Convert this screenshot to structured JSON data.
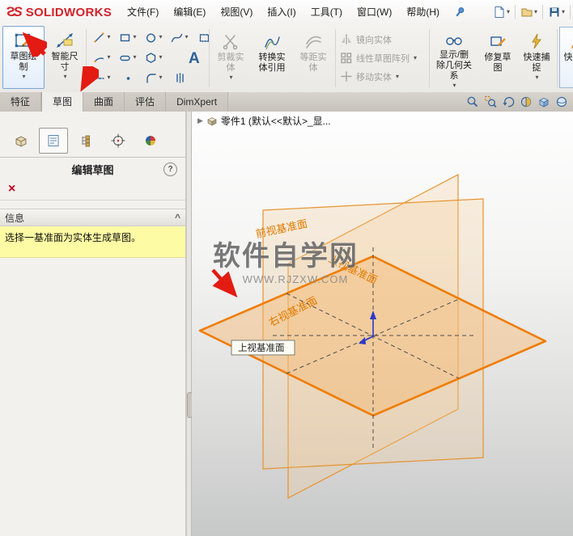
{
  "menubar": {
    "logo_mark": "S",
    "logo": "SOLIDWORKS",
    "menus": [
      "文件(F)",
      "编辑(E)",
      "视图(V)",
      "插入(I)",
      "工具(T)",
      "窗口(W)",
      "帮助(H)"
    ]
  },
  "icons": {
    "dropdown": "▾",
    "expand_arrow": "▶",
    "collapse_chevron": "^",
    "close": "×",
    "help": "?",
    "text_tool": "A"
  },
  "ribbon": {
    "sketch": "草图绘制",
    "smart_dimension": "智能尺寸",
    "trim_entities": "剪裁实体",
    "convert_entities": "转换实体引用",
    "offset_entities": "等距实体",
    "mirror_entities": "镜向实体",
    "linear_pattern": "线性草图阵列",
    "move_entities": "移动实体",
    "display_delete_relations": "显示/删除几何关系",
    "repair_sketch": "修复草图",
    "quick_snaps": "快速捕捉",
    "rapid_sketch": "快速草图"
  },
  "tabs": [
    "特征",
    "草图",
    "曲面",
    "评估",
    "DimXpert"
  ],
  "panel": {
    "title": "编辑草图",
    "info_header": "信息",
    "message": "选择一基准面为实体生成草图。"
  },
  "viewport": {
    "tree_item": "零件1 (默认<<默认>_显...",
    "front_plane_label": "前视基准面",
    "top_plane_label": "上视基准面",
    "right_plane_label": "右视基准面",
    "tooltip": "上视基准面",
    "watermark_title": "软件自学网",
    "watermark_url": "WWW.RJZXW.COM"
  },
  "colors": {
    "plane_edge": "#e8922c",
    "plane_selected_edge": "#ef7d05",
    "annotation_red": "#e31b12",
    "message_bg": "#fdfba3",
    "logo_red": "#d2232a"
  }
}
